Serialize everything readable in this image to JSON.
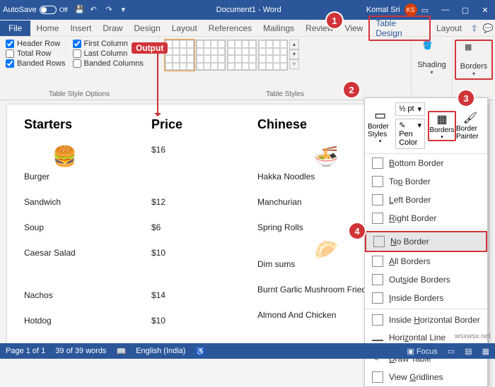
{
  "titlebar": {
    "autosave": "AutoSave",
    "off": "Off",
    "doc": "Document1 - Word",
    "user": "Komal Sri",
    "initials": "KS"
  },
  "tabs": {
    "file": "File",
    "home": "Home",
    "insert": "Insert",
    "draw": "Draw",
    "design": "Design",
    "layout": "Layout",
    "references": "References",
    "mailings": "Mailings",
    "review": "Review",
    "view": "View",
    "tabledesign": "Table Design",
    "layout2": "Layout"
  },
  "ribbon": {
    "checks": {
      "headerRow": "Header Row",
      "totalRow": "Total Row",
      "bandedRows": "Banded Rows",
      "firstCol": "First Column",
      "lastCol": "Last Column",
      "bandedCols": "Banded Columns",
      "group1": "Table Style Options"
    },
    "group2": "Table Styles",
    "shading": "Shading",
    "borders": "Borders"
  },
  "output": "Output",
  "headings": {
    "starters": "Starters",
    "price": "Price",
    "chinese": "Chinese"
  },
  "rows": [
    {
      "a": "Burger",
      "b": "$16",
      "c": "Hakka Noodles"
    },
    {
      "a": "Sandwich",
      "b": "$12",
      "c": "Manchurian"
    },
    {
      "a": "Soup",
      "b": "$6",
      "c": "Spring Rolls"
    },
    {
      "a": "Caesar Salad",
      "b": "$10",
      "c": ""
    },
    {
      "a": "",
      "b": "",
      "c": "Dim sums"
    },
    {
      "a": "Nachos",
      "b": "$14",
      "c": "Burnt Garlic Mushroom Fried Rice"
    },
    {
      "a": "Hotdog",
      "b": "$10",
      "c": "Almond And Chicken"
    }
  ],
  "dd": {
    "borderStyles": "Border Styles",
    "penColor": "Pen Color",
    "penWeight": "½ pt",
    "borders": "Borders",
    "borderPainter": "Border Painter",
    "items": {
      "bottom": "Bottom Border",
      "top": "Top Border",
      "left": "Left Border",
      "right": "Right Border",
      "none": "No Border",
      "all": "All Borders",
      "outside": "Outside Borders",
      "inside": "Inside Borders",
      "insideH": "Inside Horizontal Border",
      "hline": "Horizontal Line",
      "draw": "Draw Table",
      "grid": "View Gridlines"
    }
  },
  "status": {
    "page": "Page 1 of 1",
    "words": "39 of 39 words",
    "lang": "English (India)",
    "focus": "Focus"
  },
  "watermark": "wsxwsx.net"
}
